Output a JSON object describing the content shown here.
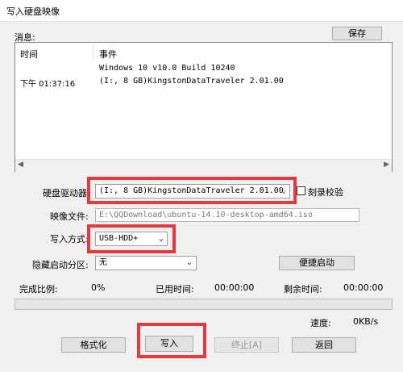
{
  "window": {
    "title": "写入硬盘映像"
  },
  "messages": {
    "label": "消息:",
    "save_label": "保存",
    "columns": [
      "时间",
      "事件"
    ],
    "rows": [
      {
        "time": "",
        "event": "Windows 10 v10.0 Build 10240"
      },
      {
        "time": "下午 01:37:16",
        "event": "(I:, 8 GB)KingstonDataTraveler 2.01.00"
      }
    ]
  },
  "drive": {
    "label": "硬盘驱动器:",
    "value": "(I:, 8 GB)KingstonDataTraveler 2.01.00",
    "verify_label": "刻录校验"
  },
  "image_file": {
    "label": "映像文件:",
    "value": "E:\\QQDownload\\ubuntu-14.10-desktop-amd64.iso"
  },
  "write_mode": {
    "label": "写入方式:",
    "value": "USB-HDD+"
  },
  "hidden_partition": {
    "label": "隐藏启动分区:",
    "value": "无",
    "boot_label": "便捷启动"
  },
  "stats": {
    "complete_label": "完成比例:",
    "complete_value": "0%",
    "elapsed_label": "已用时间:",
    "elapsed_value": "00:00:00",
    "remaining_label": "剩余时间:",
    "remaining_value": "00:00:00",
    "speed_label": "速度:",
    "speed_value": "0KB/s",
    "progress": 0
  },
  "buttons": {
    "format": "格式化",
    "write": "写入",
    "terminate": "终止[A]",
    "back": "返回"
  },
  "colors": {
    "highlight": "#e8383d"
  }
}
